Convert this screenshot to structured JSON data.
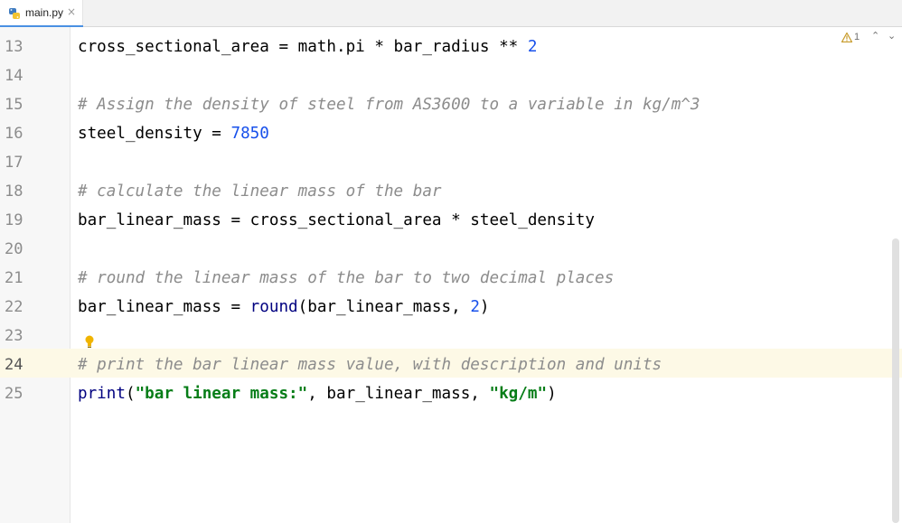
{
  "tab": {
    "filename": "main.py",
    "close": "×"
  },
  "inspections": {
    "warning_count": "1",
    "up": "⌃",
    "down": "⌄"
  },
  "line_numbers": [
    "13",
    "14",
    "15",
    "16",
    "17",
    "18",
    "19",
    "20",
    "21",
    "22",
    "23",
    "24",
    "25"
  ],
  "code": {
    "line13": {
      "a": "cross_sectional_area = math.pi * bar_radius ** ",
      "b": "2"
    },
    "line15": "# Assign the density of steel from AS3600 to a variable in kg/m^3",
    "line16": {
      "a": "steel_density = ",
      "b": "7850"
    },
    "line18": "# calculate the linear mass of the bar",
    "line19": "bar_linear_mass = cross_sectional_area * steel_density",
    "line21": "# round the linear mass of the bar to two decimal places",
    "line22": {
      "a": "bar_linear_mass = ",
      "fn": "round",
      "b": "(bar_linear_mass, ",
      "n": "2",
      "c": ")"
    },
    "line24": "# print the bar linear mass value, with description and units",
    "line25": {
      "fn": "print",
      "a": "(",
      "s1": "\"bar linear mass:\"",
      "b": ", bar_linear_mass, ",
      "s2": "\"kg/m\"",
      "c": ")"
    }
  },
  "colors": {
    "comment": "#8c8c8c",
    "number": "#1750eb",
    "builtin": "#000080",
    "string": "#067d17",
    "current_line": "#fdf9e6"
  }
}
